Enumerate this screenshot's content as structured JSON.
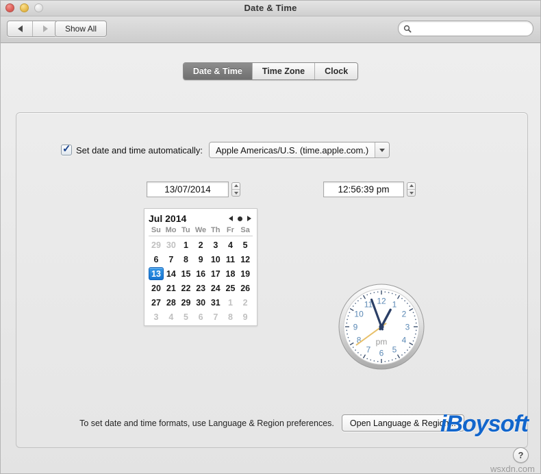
{
  "window": {
    "title": "Date & Time",
    "traffic_lights": [
      "close-button",
      "minimize-button",
      "zoom-button"
    ]
  },
  "toolbar": {
    "back_label": "",
    "forward_label": "",
    "show_all_label": "Show All",
    "search": {
      "value": "",
      "placeholder": "",
      "icon": "search-icon"
    }
  },
  "tabs": [
    {
      "label": "Date & Time",
      "active": true
    },
    {
      "label": "Time Zone",
      "active": false
    },
    {
      "label": "Clock",
      "active": false
    }
  ],
  "auto_row": {
    "checkbox_checked": true,
    "checkbox_glyph": "✓",
    "label": "Set date and time automatically:",
    "server_value": "Apple Americas/U.S. (time.apple.com.)",
    "server_options": [
      "Apple Americas/U.S. (time.apple.com.)"
    ]
  },
  "fields": {
    "date_value": "13/07/2014",
    "time_value": "12:56:39 pm"
  },
  "calendar": {
    "month_label": "Jul 2014",
    "weekdays": [
      "Su",
      "Mo",
      "Tu",
      "We",
      "Th",
      "Fr",
      "Sa"
    ],
    "selected_day": 13,
    "weeks": [
      [
        {
          "d": "29",
          "other": true
        },
        {
          "d": "30",
          "other": true
        },
        {
          "d": "1"
        },
        {
          "d": "2"
        },
        {
          "d": "3"
        },
        {
          "d": "4"
        },
        {
          "d": "5"
        }
      ],
      [
        {
          "d": "6"
        },
        {
          "d": "7"
        },
        {
          "d": "8"
        },
        {
          "d": "9"
        },
        {
          "d": "10"
        },
        {
          "d": "11"
        },
        {
          "d": "12"
        }
      ],
      [
        {
          "d": "13",
          "selected": true
        },
        {
          "d": "14"
        },
        {
          "d": "15"
        },
        {
          "d": "16"
        },
        {
          "d": "17"
        },
        {
          "d": "18"
        },
        {
          "d": "19"
        }
      ],
      [
        {
          "d": "20"
        },
        {
          "d": "21"
        },
        {
          "d": "22"
        },
        {
          "d": "23"
        },
        {
          "d": "24"
        },
        {
          "d": "25"
        },
        {
          "d": "26"
        }
      ],
      [
        {
          "d": "27"
        },
        {
          "d": "28"
        },
        {
          "d": "29"
        },
        {
          "d": "30"
        },
        {
          "d": "31"
        },
        {
          "d": "1",
          "other": true
        },
        {
          "d": "2",
          "other": true
        }
      ],
      [
        {
          "d": "3",
          "other": true
        },
        {
          "d": "4",
          "other": true
        },
        {
          "d": "5",
          "other": true
        },
        {
          "d": "6",
          "other": true
        },
        {
          "d": "7",
          "other": true
        },
        {
          "d": "8",
          "other": true
        },
        {
          "d": "9",
          "other": true
        }
      ]
    ]
  },
  "clock": {
    "meridiem_label": "pm",
    "hours": 12,
    "minutes": 56,
    "seconds": 39,
    "numerals": [
      "12",
      "1",
      "2",
      "3",
      "4",
      "5",
      "6",
      "7",
      "8",
      "9",
      "10",
      "11"
    ],
    "numeral_color": "#5b89b5",
    "hand_color": "#2b3f66",
    "second_hand_color": "#e8c06a"
  },
  "footer": {
    "text": "To set date and time formats, use Language & Region preferences.",
    "button_label": "Open Language & Region..."
  },
  "branding": {
    "logo_text": "iBoysoft",
    "logo_color": "#1266cc",
    "help_label": "?",
    "watermark": "wsxdn.com"
  }
}
